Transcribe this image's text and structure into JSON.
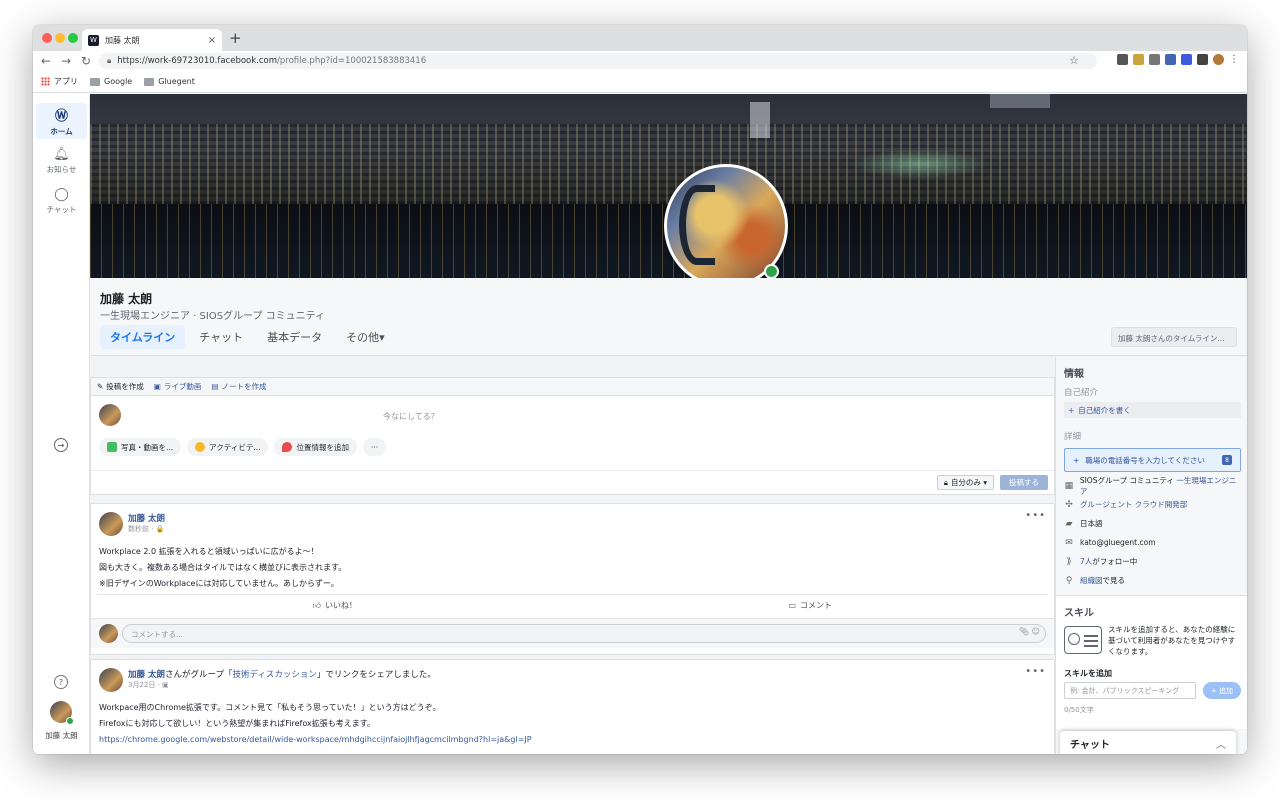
{
  "browser": {
    "tab_title": "加藤 太朗",
    "tab_close": "×",
    "new_tab": "+",
    "url_main": "https://work-69723010.facebook.com",
    "url_path": "/profile.php?id=100021583883416",
    "bookmarks": [
      {
        "label": "アプリ"
      },
      {
        "label": "Google"
      },
      {
        "label": "Gluegent"
      }
    ]
  },
  "leftnav": {
    "home": "ホーム",
    "notifications": "お知らせ",
    "chat": "チャット",
    "user_name": "加藤 太朗"
  },
  "profile": {
    "name": "加藤 太朗",
    "subtitle": "一生現場エンジニア · SIOSグループ コミュニティ",
    "tabs": [
      "タイムライン",
      "チャット",
      "基本データ",
      "その他▾"
    ],
    "timeline_search": "加藤 太朗さんのタイムライン..."
  },
  "composer": {
    "tabs": [
      "投稿を作成",
      "ライブ動画",
      "ノートを作成"
    ],
    "placeholder": "今なにしてる？",
    "chips": [
      "写真・動画を...",
      "アクティビテ...",
      "位置情報を追加",
      "···"
    ],
    "privacy": "自分のみ ▾",
    "post_button": "投稿する"
  },
  "posts": [
    {
      "author": "加藤 太朗",
      "time": "数秒前 · 🔒",
      "lines": [
        "Workplace 2.0 拡張を入れると領域いっぱいに広がるよ〜！",
        "図も大きく。複数ある場合はタイルではなく横並びに表示されます。",
        "※旧デザインのWorkplaceには対応していません。あしからずー。"
      ],
      "like": "いいね！",
      "comment": "コメント",
      "comment_placeholder": "コメントする..."
    },
    {
      "author": "加藤 太朗",
      "shared_mid": "さんがグループ「",
      "group": "技術ディスカッション",
      "shared_end": "」でリンクをシェアしました。",
      "time": "3月22日 · ▣",
      "lines": [
        "Workpace用のChrome拡張です。コメント見て「私もそう思っていた！」という方はどうぞ。",
        "Firefoxにも対応して欲しい！という熱望が集まればFirefox拡張も考えます。"
      ],
      "link": "https://chrome.google.com/webstore/detail/wide-workspace/mhdgihccijnfaiojlhfjagcmcilmbgnd?hl=ja&gl=JP"
    }
  ],
  "info": {
    "title": "情報",
    "intro_label": "自己紹介",
    "intro_action": "自己紹介を書く",
    "details_label": "詳細",
    "phone_prompt": "職場の電話番号を入力してください",
    "phone_badge": "8",
    "items": [
      {
        "icon": "building-icon",
        "glyph": "▦",
        "text": "SIOSグループ コミュニティ ",
        "link": "一生現場エンジニア"
      },
      {
        "icon": "team-icon",
        "glyph": "✣",
        "text": "",
        "link": "グルージェント クラウド開発部"
      },
      {
        "icon": "language-icon",
        "glyph": "▰",
        "text": "日本語",
        "link": ""
      },
      {
        "icon": "mail-icon",
        "glyph": "✉",
        "text": "kato@gluegent.com",
        "link": ""
      },
      {
        "icon": "rss-icon",
        "glyph": "⟫",
        "link": "7人",
        "text": "がフォロー中"
      },
      {
        "icon": "org-chart-icon",
        "glyph": "⚲",
        "link": "組織図",
        "text": "で見る"
      }
    ]
  },
  "skills": {
    "title": "スキル",
    "description": "スキルを追加すると、あなたの経験に基づいて利用者があなたを見つけやすくなります。",
    "add_label": "スキルを追加",
    "input_placeholder": "例: 会計、パブリックスピーキング",
    "add_button": "+ 追加",
    "char_count": "0/50文字"
  },
  "chat_bar": {
    "label": "チャット",
    "chevron": "︿"
  }
}
